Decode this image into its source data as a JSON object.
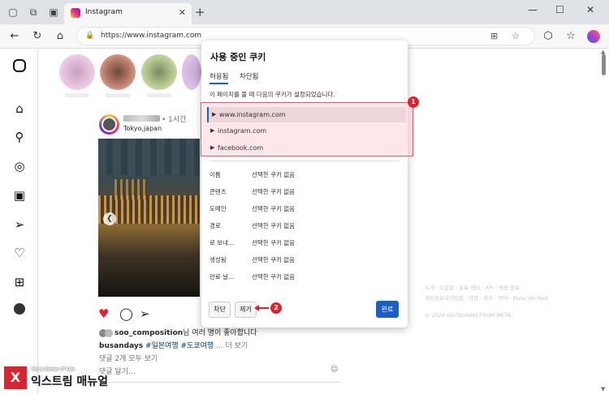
{
  "browser": {
    "tab_title": "Instagram",
    "url": "https://www.instagram.com"
  },
  "post": {
    "time": "• 1시간",
    "location": "Tokyo,japan",
    "likes_user": "soo_composition",
    "likes_suffix": "님 여러 명이 좋아합니다",
    "caption_user": "busandays",
    "caption_tags": "#일본여행 #도쿄여행",
    "caption_more": "... 더 보기",
    "comments_link": "댓글 2개 모두 보기",
    "comment_placeholder": "댓글 달기..."
  },
  "footer": {
    "line1": "소개 · 도움말 · 홍보 센터 · API · 채용 정보 ·",
    "line2": "개인정보처리방침 · 약관 · 위치 · 언어 · Meta Verified",
    "line3": "© 2024 INSTAGRAM FROM META"
  },
  "dialog": {
    "title": "사용 중인 쿠키",
    "tabs": [
      "허용됨",
      "차단됨"
    ],
    "description": "이 페이지를 볼 때 다음의 쿠키가 설정되었습니다.",
    "cookies": [
      "www.instagram.com",
      "instagram.com",
      "facebook.com"
    ],
    "details": [
      {
        "key": "이름",
        "value": "선택한 쿠키 없음"
      },
      {
        "key": "콘텐츠",
        "value": "선택한 쿠키 없음"
      },
      {
        "key": "도메인",
        "value": "선택한 쿠키 없음"
      },
      {
        "key": "경로",
        "value": "선택한 쿠키 없음"
      },
      {
        "key": "로 보내...",
        "value": "선택한 쿠키 없음"
      },
      {
        "key": "생성됨",
        "value": "선택한 쿠키 없음"
      },
      {
        "key": "만료 날...",
        "value": "선택한 쿠키 없음"
      }
    ],
    "block_label": "차단",
    "remove_label": "제거",
    "done_label": "완료"
  },
  "annotations": {
    "badge1": "1",
    "badge2": "2"
  },
  "watermark": {
    "logo_letter": "X",
    "sub": "More Better IT Life",
    "main": "익스트림 매뉴얼"
  },
  "colors": {
    "accent": "#1a5fc4",
    "highlight_border": "#e35b6a",
    "badge": "#d8252f"
  }
}
